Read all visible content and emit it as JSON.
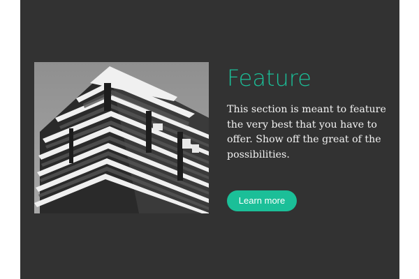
{
  "feature": {
    "title": "Feature",
    "description": "This section is meant to feature the very best that you have to offer. Show off the great of the possibilities.",
    "button_label": "Learn more",
    "image_icon": "building-photo"
  },
  "colors": {
    "background": "#323232",
    "accent": "#1bbf98",
    "text": "#f2f2f2"
  }
}
